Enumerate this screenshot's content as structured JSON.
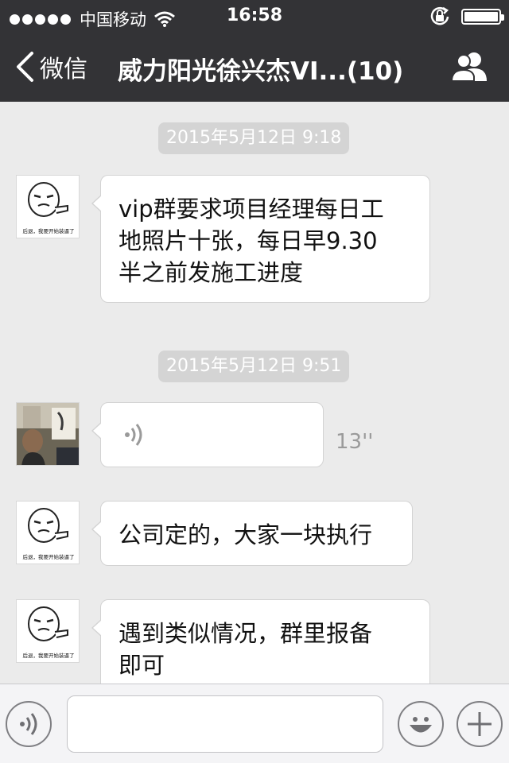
{
  "status_bar": {
    "carrier": "中国移动",
    "time": "16:58",
    "signal_icon": "signal-dots-icon",
    "wifi_icon": "wifi-icon",
    "lock_icon": "rotation-lock-icon",
    "battery_icon": "battery-full-icon",
    "battery_level": 1.0
  },
  "nav": {
    "back_label": "微信",
    "back_icon": "chevron-left-icon",
    "title": "威力阳光徐兴杰VI...(10)",
    "members_icon": "group-members-icon"
  },
  "chat": {
    "timestamps": [
      "2015年5月12日 9:18",
      "2015年5月12日 9:51"
    ],
    "messages": [
      {
        "type": "text",
        "avatar": "meme-face-avatar",
        "avatar_caption": "后退，我要开始装逼了",
        "lines": [
          "vip群要求项目经理每日工",
          "地照片十张，每日早9.30",
          "半之前发施工进度"
        ]
      },
      {
        "type": "voice",
        "avatar": "man-photo-avatar",
        "voice_icon": "voice-wave-icon",
        "duration": "13''"
      },
      {
        "type": "text",
        "avatar": "meme-face-avatar",
        "avatar_caption": "后退，我要开始装逼了",
        "lines": [
          "公司定的，大家一块执行"
        ]
      },
      {
        "type": "text",
        "avatar": "meme-face-avatar",
        "avatar_caption": "后退，我要开始装逼了",
        "lines": [
          "遇到类似情况，群里报备",
          "即可"
        ]
      }
    ]
  },
  "input_bar": {
    "voice_button_icon": "voice-input-icon",
    "text_value": "",
    "emoji_button_icon": "emoji-smiley-icon",
    "more_button_icon": "plus-icon"
  },
  "colors": {
    "header_bg": "#333336",
    "chat_bg": "#ebebeb",
    "timestamp_pill": "#d4d4d4",
    "bubble_bg": "#ffffff"
  }
}
